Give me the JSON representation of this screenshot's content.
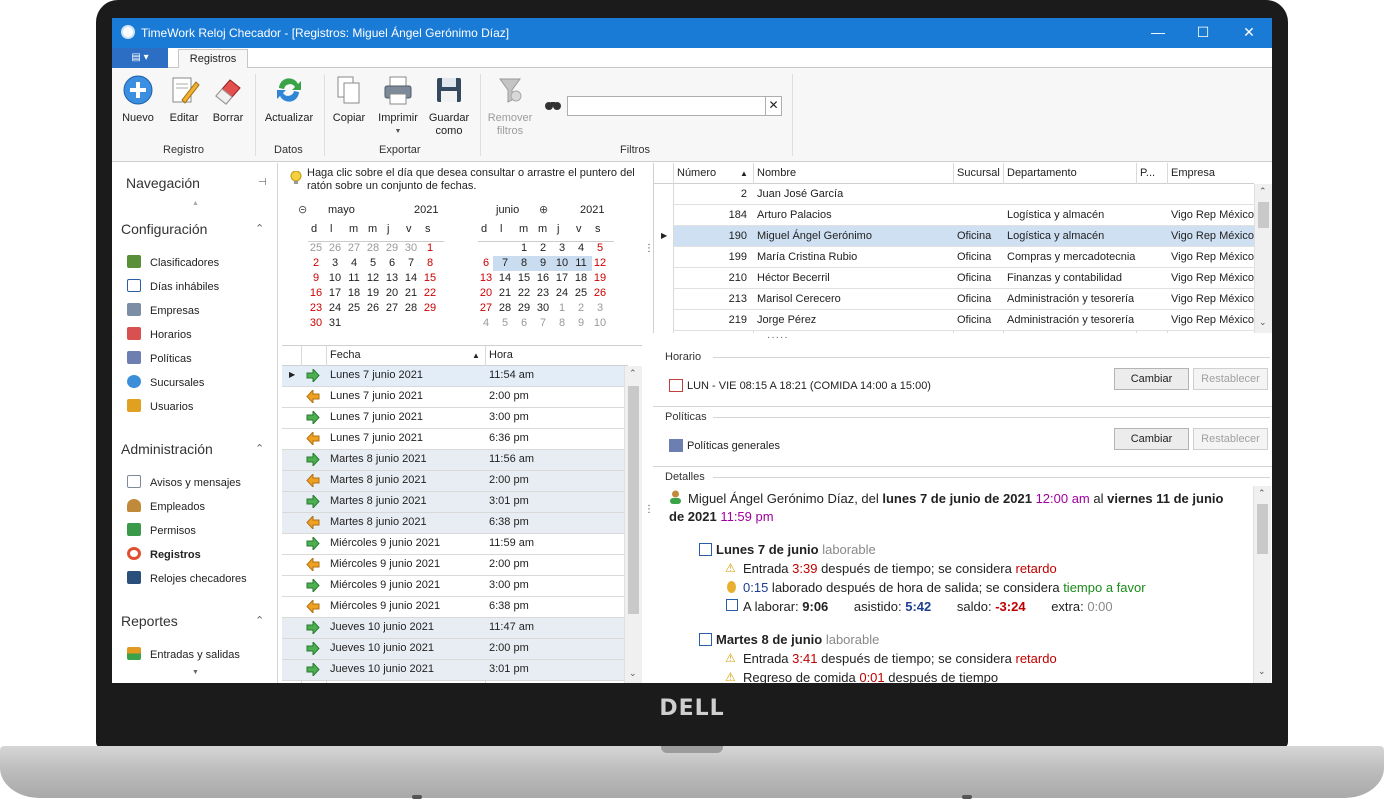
{
  "window": {
    "title": "TimeWork Reloj Checador - [Registros: Miguel Ángel Gerónimo Díaz]",
    "min": "—",
    "max": "☐",
    "close": "✕"
  },
  "ribbon": {
    "tab": "Registros",
    "file_menu": "▤ ▾",
    "buttons": {
      "nuevo": "Nuevo",
      "editar": "Editar",
      "borrar": "Borrar",
      "actualizar": "Actualizar",
      "copiar": "Copiar",
      "imprimir": "Imprimir",
      "guardar1": "Guardar",
      "guardar2": "como",
      "remover1": "Remover",
      "remover2": "filtros"
    },
    "groups": {
      "registro": "Registro",
      "datos": "Datos",
      "exportar": "Exportar",
      "filtros": "Filtros"
    },
    "search": {
      "value": "",
      "placeholder": "",
      "clear": "✕"
    }
  },
  "nav": {
    "title": "Navegación",
    "config_title": "Configuración",
    "config": [
      "Clasificadores",
      "Días inhábiles",
      "Empresas",
      "Horarios",
      "Políticas",
      "Sucursales",
      "Usuarios"
    ],
    "admin_title": "Administración",
    "admin": [
      "Avisos y mensajes",
      "Empleados",
      "Permisos",
      "Registros",
      "Relojes checadores"
    ],
    "reports_title": "Reportes",
    "reports": [
      "Entradas y salidas"
    ]
  },
  "calendar": {
    "hint": "Haga clic sobre el día que desea consultar o arrastre el puntero del ratón sobre un conjunto de fechas.",
    "left_month": "mayo",
    "left_year": "2021",
    "right_month": "junio",
    "right_year": "2021",
    "dow": [
      "d",
      "l",
      "m",
      "m",
      "j",
      "v",
      "s"
    ],
    "may": [
      [
        "25",
        "26",
        "27",
        "28",
        "29",
        "30",
        "1"
      ],
      [
        "2",
        "3",
        "4",
        "5",
        "6",
        "7",
        "8"
      ],
      [
        "9",
        "10",
        "11",
        "12",
        "13",
        "14",
        "15"
      ],
      [
        "16",
        "17",
        "18",
        "19",
        "20",
        "21",
        "22"
      ],
      [
        "23",
        "24",
        "25",
        "26",
        "27",
        "28",
        "29"
      ],
      [
        "30",
        "31",
        "",
        "",
        "",
        "",
        ""
      ]
    ],
    "june": [
      [
        "",
        "",
        "1",
        "2",
        "3",
        "4",
        "5"
      ],
      [
        "6",
        "7",
        "8",
        "9",
        "10",
        "11",
        "12"
      ],
      [
        "13",
        "14",
        "15",
        "16",
        "17",
        "18",
        "19"
      ],
      [
        "20",
        "21",
        "22",
        "23",
        "24",
        "25",
        "26"
      ],
      [
        "27",
        "28",
        "29",
        "30",
        "1",
        "2",
        "3"
      ],
      [
        "4",
        "5",
        "6",
        "7",
        "8",
        "9",
        "10"
      ]
    ]
  },
  "records": {
    "headers": {
      "fecha": "Fecha",
      "hora": "Hora"
    },
    "rows": [
      {
        "fecha": "Lunes 7 junio 2021",
        "hora": "11:54 am",
        "dir": "in"
      },
      {
        "fecha": "Lunes 7 junio 2021",
        "hora": "2:00 pm",
        "dir": "out"
      },
      {
        "fecha": "Lunes 7 junio 2021",
        "hora": "3:00 pm",
        "dir": "in"
      },
      {
        "fecha": "Lunes 7 junio 2021",
        "hora": "6:36 pm",
        "dir": "out"
      },
      {
        "fecha": "Martes 8 junio 2021",
        "hora": "11:56 am",
        "dir": "in"
      },
      {
        "fecha": "Martes 8 junio 2021",
        "hora": "2:00 pm",
        "dir": "out"
      },
      {
        "fecha": "Martes 8 junio 2021",
        "hora": "3:01 pm",
        "dir": "in"
      },
      {
        "fecha": "Martes 8 junio 2021",
        "hora": "6:38 pm",
        "dir": "out"
      },
      {
        "fecha": "Miércoles 9 junio 2021",
        "hora": "11:59 am",
        "dir": "in"
      },
      {
        "fecha": "Miércoles 9 junio 2021",
        "hora": "2:00 pm",
        "dir": "out"
      },
      {
        "fecha": "Miércoles 9 junio 2021",
        "hora": "3:00 pm",
        "dir": "in"
      },
      {
        "fecha": "Miércoles 9 junio 2021",
        "hora": "6:38 pm",
        "dir": "out"
      },
      {
        "fecha": "Jueves 10 junio 2021",
        "hora": "11:47 am",
        "dir": "in"
      },
      {
        "fecha": "Jueves 10 junio 2021",
        "hora": "2:00 pm",
        "dir": "in"
      },
      {
        "fecha": "Jueves 10 junio 2021",
        "hora": "3:01 pm",
        "dir": "in"
      }
    ]
  },
  "employees": {
    "headers": {
      "numero": "Número",
      "nombre": "Nombre",
      "sucursal": "Sucursal",
      "departamento": "Departamento",
      "p": "P...",
      "empresa": "Empresa"
    },
    "rows": [
      {
        "numero": "2",
        "nombre": "Juan José García",
        "sucursal": "",
        "departamento": "",
        "empresa": ""
      },
      {
        "numero": "184",
        "nombre": "Arturo Palacios",
        "sucursal": "",
        "departamento": "Logística y almacén",
        "empresa": "Vigo Rep México"
      },
      {
        "numero": "190",
        "nombre": "Miguel Ángel Gerónimo",
        "sucursal": "Oficina",
        "departamento": "Logística y almacén",
        "empresa": "Vigo Rep México"
      },
      {
        "numero": "199",
        "nombre": "María Cristina Rubio",
        "sucursal": "Oficina",
        "departamento": "Compras y mercadotecnia",
        "empresa": "Vigo Rep México"
      },
      {
        "numero": "210",
        "nombre": "Héctor Becerril",
        "sucursal": "Oficina",
        "departamento": "Finanzas y contabilidad",
        "empresa": "Vigo Rep México"
      },
      {
        "numero": "213",
        "nombre": "Marisol Cerecero",
        "sucursal": "Oficina",
        "departamento": "Administración y tesorería",
        "empresa": "Vigo Rep México"
      },
      {
        "numero": "219",
        "nombre": "Jorge Pérez",
        "sucursal": "Oficina",
        "departamento": "Administración y tesorería",
        "empresa": "Vigo Rep México"
      }
    ]
  },
  "horario": {
    "title": "Horario",
    "text": "LUN - VIE 08:15 A 18:21 (COMIDA 14:00 a 15:00)",
    "cambiar": "Cambiar",
    "restablecer": "Restablecer"
  },
  "politicas": {
    "title": "Políticas",
    "text": "Políticas generales",
    "cambiar": "Cambiar",
    "restablecer": "Restablecer"
  },
  "detalles": {
    "title": "Detalles",
    "summary": {
      "name": "Miguel Ángel Gerónimo Díaz, del ",
      "from": "lunes 7 de junio de 2021",
      "from_time": "12:00 am",
      "to_label": " al ",
      "to": "viernes 11 de junio",
      "to2": "de 2021",
      "to_time": "11:59 pm"
    },
    "day1": {
      "title": "Lunes 7 de junio",
      "kind": "laborable",
      "l1a": "Entrada ",
      "l1b": "3:39",
      "l1c": " después de tiempo; se considera ",
      "l1d": "retardo",
      "l2a": "0:15",
      "l2b": " laborado después de hora de salida; se considera ",
      "l2c": "tiempo a favor",
      "l3a": "A laborar: ",
      "l3b": "9:06",
      "l3c": "asistido: ",
      "l3d": "5:42",
      "l3e": "saldo: ",
      "l3f": "-3:24",
      "l3g": "extra: ",
      "l3h": "0:00"
    },
    "day2": {
      "title": "Martes 8 de junio",
      "kind": "laborable",
      "l1a": "Entrada ",
      "l1b": "3:41",
      "l1c": " después de tiempo; se considera ",
      "l1d": "retardo",
      "l2a": "Regreso de comida ",
      "l2b": "0:01",
      "l2c": " después de tiempo"
    }
  },
  "laptop": {
    "brand": "DELL"
  },
  "colors": {
    "titlebar": "#1a7bd6",
    "selection": "#cfe0f3",
    "weekend": "#cc0000"
  }
}
